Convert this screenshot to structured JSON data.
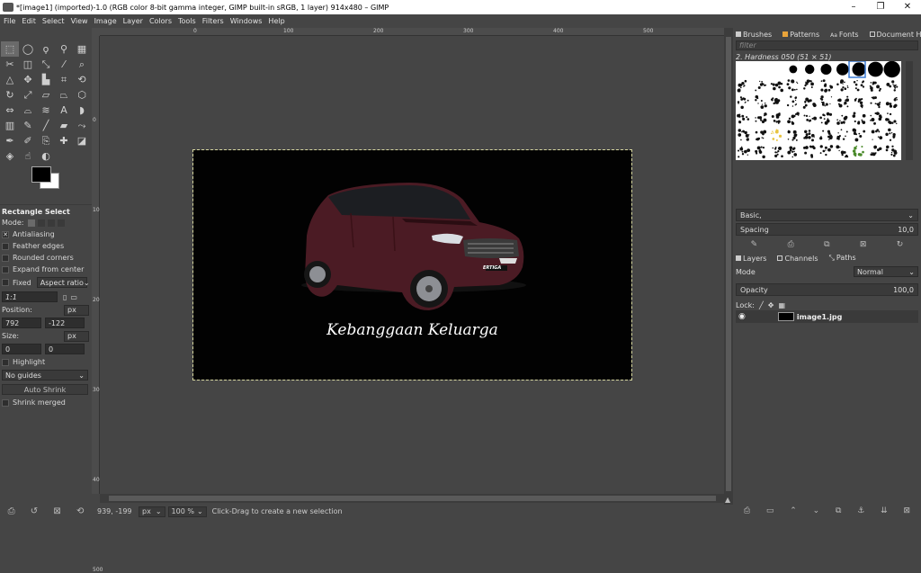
{
  "window": {
    "title": "*[image1] (imported)-1.0 (RGB color 8-bit gamma integer, GIMP built-in sRGB, 1 layer) 914x480 – GIMP",
    "controls": [
      "–",
      "❐",
      "✕"
    ]
  },
  "menu": [
    "File",
    "Edit",
    "Select",
    "View",
    "Image",
    "Layer",
    "Colors",
    "Tools",
    "Filters",
    "Windows",
    "Help"
  ],
  "toolbox": {
    "tools": [
      {
        "name": "rect-select",
        "glyph": "⬚",
        "active": true
      },
      {
        "name": "ellipse-select",
        "glyph": "◯"
      },
      {
        "name": "free-select",
        "glyph": "ϙ"
      },
      {
        "name": "fuzzy-select",
        "glyph": "⚲"
      },
      {
        "name": "select-by-color",
        "glyph": "▦"
      },
      {
        "name": "scissors",
        "glyph": "✂"
      },
      {
        "name": "foreground-select",
        "glyph": "◫"
      },
      {
        "name": "paths",
        "glyph": "⤡"
      },
      {
        "name": "color-picker",
        "glyph": "⁄"
      },
      {
        "name": "zoom",
        "glyph": "⌕"
      },
      {
        "name": "measure",
        "glyph": "△"
      },
      {
        "name": "move",
        "glyph": "✥"
      },
      {
        "name": "align",
        "glyph": "▙"
      },
      {
        "name": "crop",
        "glyph": "⌗"
      },
      {
        "name": "unified-transform",
        "glyph": "⟲"
      },
      {
        "name": "rotate",
        "glyph": "↻"
      },
      {
        "name": "scale",
        "glyph": "⤢"
      },
      {
        "name": "shear",
        "glyph": "▱"
      },
      {
        "name": "perspective",
        "glyph": "⏢"
      },
      {
        "name": "3d-transform",
        "glyph": "⬡"
      },
      {
        "name": "flip",
        "glyph": "⇔"
      },
      {
        "name": "cage",
        "glyph": "⌓"
      },
      {
        "name": "warp",
        "glyph": "≋"
      },
      {
        "name": "text",
        "glyph": "A"
      },
      {
        "name": "bucket-fill",
        "glyph": "◗"
      },
      {
        "name": "gradient",
        "glyph": "▥"
      },
      {
        "name": "pencil",
        "glyph": "✎"
      },
      {
        "name": "paintbrush",
        "glyph": "╱"
      },
      {
        "name": "eraser",
        "glyph": "▰"
      },
      {
        "name": "airbrush",
        "glyph": "⤳"
      },
      {
        "name": "ink",
        "glyph": "✒"
      },
      {
        "name": "mypaint-brush",
        "glyph": "✐"
      },
      {
        "name": "clone",
        "glyph": "⎘"
      },
      {
        "name": "heal",
        "glyph": "✚"
      },
      {
        "name": "perspective-clone",
        "glyph": "◪"
      },
      {
        "name": "blur-sharpen",
        "glyph": "◈"
      },
      {
        "name": "smudge",
        "glyph": "☝"
      },
      {
        "name": "dodge-burn",
        "glyph": "◐"
      }
    ]
  },
  "tool_options": {
    "title": "Rectangle Select",
    "mode_label": "Mode:",
    "antialiasing": "Antialiasing",
    "feather_edges": "Feather edges",
    "rounded_corners": "Rounded corners",
    "expand_from_center": "Expand from center",
    "fixed": "Fixed",
    "aspect_ratio": "Aspect ratio",
    "ratio_value": "1:1",
    "position_label": "Position:",
    "position_unit": "px",
    "position_x": "792",
    "position_y": "-122",
    "size_label": "Size:",
    "size_unit": "px",
    "size_w": "0",
    "size_h": "0",
    "highlight": "Highlight",
    "guides": "No guides",
    "auto_shrink": "Auto Shrink",
    "shrink_merged": "Shrink merged"
  },
  "rulers": {
    "horizontal": [
      "0",
      "100",
      "200",
      "300",
      "400",
      "500",
      "600",
      "700",
      "800"
    ],
    "vertical": [
      "0",
      "100",
      "200",
      "300",
      "400",
      "500"
    ]
  },
  "image": {
    "slogan": "Kebanggaan Keluarga",
    "badge": "ERTIGA"
  },
  "statusbar": {
    "coords": "939, -199",
    "unit": "px",
    "zoom": "100 %",
    "hint": "Click-Drag to create a new selection"
  },
  "right_dock": {
    "top_tabs": [
      "Brushes",
      "Patterns",
      "Fonts",
      "Document History"
    ],
    "filter_placeholder": "filter",
    "brush_name": "2. Hardness 050 (51 × 51)",
    "preset": "Basic,",
    "spacing_label": "Spacing",
    "spacing_value": "10,0",
    "layer_tabs": [
      "Layers",
      "Channels",
      "Paths"
    ],
    "mode_label": "Mode",
    "mode_value": "Normal",
    "opacity_label": "Opacity",
    "opacity_value": "100,0",
    "lock_label": "Lock:",
    "layer_name": "image1.jpg"
  }
}
